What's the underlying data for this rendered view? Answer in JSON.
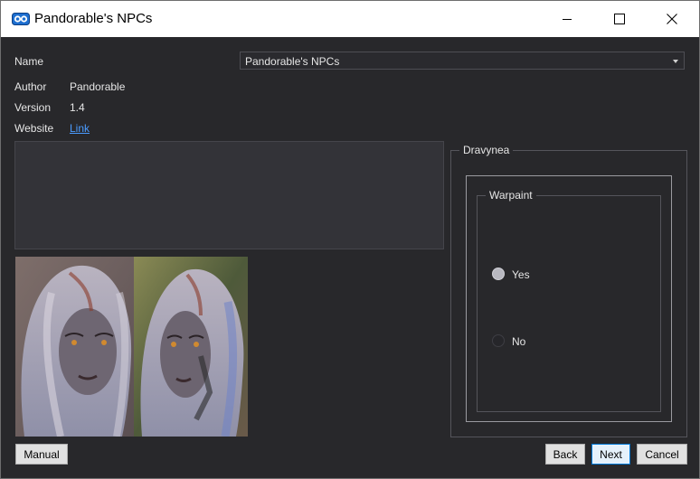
{
  "window": {
    "title": "Pandorable's NPCs"
  },
  "details": {
    "name_label": "Name",
    "author_label": "Author",
    "author_value": "Pandorable",
    "version_label": "Version",
    "version_value": "1.4",
    "website_label": "Website",
    "website_link": "Link"
  },
  "name_select": {
    "selected": "Pandorable's NPCs"
  },
  "options": {
    "group_title": "Dravynea",
    "subgroup_title": "Warpaint",
    "choices": [
      {
        "label": "Yes",
        "selected": true
      },
      {
        "label": "No",
        "selected": false
      }
    ]
  },
  "buttons": {
    "manual": "Manual",
    "back": "Back",
    "next": "Next",
    "cancel": "Cancel"
  },
  "colors": {
    "background": "#28282b",
    "link": "#4a9bff",
    "focus_border": "#0078d7"
  }
}
